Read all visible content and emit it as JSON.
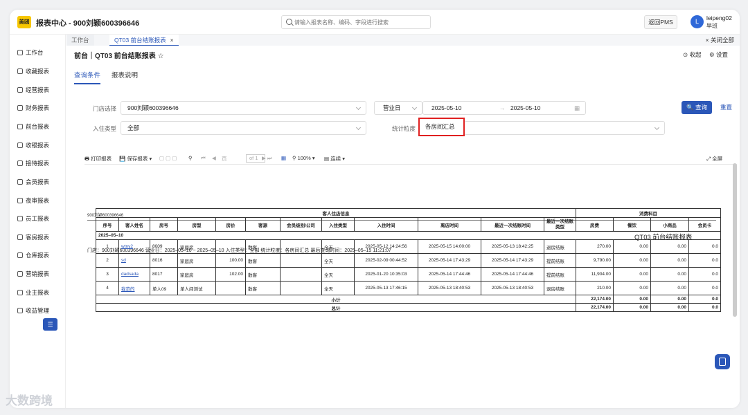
{
  "app": {
    "logo": "美团",
    "title": "报表中心 - 900刘颖600396646"
  },
  "search": {
    "placeholder": "请输入报表名称、编码、字段进行搜索"
  },
  "header": {
    "pms_button": "返回PMS",
    "avatar_letter": "L",
    "username": "leipeng02",
    "shift": "早班"
  },
  "sidebar": {
    "items": [
      {
        "label": "工作台",
        "icon": "home-icon"
      },
      {
        "label": "收藏报表",
        "icon": "star-icon"
      },
      {
        "label": "经营报表",
        "icon": "chart-icon"
      },
      {
        "label": "财务报表",
        "icon": "finance-icon"
      },
      {
        "label": "前台报表",
        "icon": "user-icon"
      },
      {
        "label": "收银报表",
        "icon": "cashier-icon"
      },
      {
        "label": "接待报表",
        "icon": "reception-icon"
      },
      {
        "label": "会员报表",
        "icon": "member-icon"
      },
      {
        "label": "夜审报表",
        "icon": "moon-icon"
      },
      {
        "label": "员工报表",
        "icon": "staff-icon"
      },
      {
        "label": "客房报表",
        "icon": "room-icon"
      },
      {
        "label": "仓库报表",
        "icon": "warehouse-icon"
      },
      {
        "label": "营销报表",
        "icon": "marketing-icon"
      },
      {
        "label": "业主报表",
        "icon": "owner-icon"
      },
      {
        "label": "收益管理",
        "icon": "revenue-icon"
      }
    ],
    "collapse_icon": "menu-icon"
  },
  "tabs": [
    {
      "label": "工作台"
    },
    {
      "label": "QT03 前台结账报表",
      "close": "×"
    }
  ],
  "close_all": "× 关闭全部",
  "page": {
    "title": "前台｜QT03 前台结账报表",
    "star": "☆",
    "collapse": "收起",
    "settings": "设置",
    "query_tabs": [
      "查询条件",
      "报表说明"
    ]
  },
  "form": {
    "store_label": "门店选择",
    "store_value": "900刘颖600396646",
    "bizdate_label": "营业日",
    "date_from": "2025-05-10",
    "date_to": "2025-05-10",
    "arrow": "→",
    "stay_label": "入住类型",
    "stay_value": "全部",
    "granularity_label": "统计粒度",
    "granularity_value": "各房间汇总",
    "query_button": "查询",
    "reset_button": "重置"
  },
  "toolbar": {
    "print": "打印报表",
    "save": "保存报表",
    "page_label": "页",
    "page_of": "of 1",
    "zoom": "100%",
    "view": "连续",
    "fullscreen": "全屏"
  },
  "report": {
    "store_line": "900刘颖600396646",
    "title": "QT03 前台结账报表",
    "info": "门店：900刘颖600396646    营业日：2025–05–10 ~ 2025–05–10    入住类型：全部    统计粒度：各房间汇总    最后查询时间：2025–05–15 11:21:07",
    "group_guest": "客人住店信息",
    "group_consume": "消费科目",
    "headers": [
      "序号",
      "客人姓名",
      "房号",
      "房型",
      "房价",
      "客源",
      "会员级别/公司",
      "入住类型",
      "入住时间",
      "离店时间",
      "最近一次结账时间",
      "最近一次结账类型",
      "房费",
      "餐饮",
      "小商品",
      "会员卡"
    ],
    "date_group": "2025–05–10",
    "rows": [
      [
        "1",
        "wtny2",
        "8009",
        "家庭房",
        "",
        "散客",
        "",
        "全天",
        "2025-05-12 14:24:56",
        "2025-05-15 14:00:00",
        "2025-05-13 18:42:25",
        "退房结账",
        "270.00",
        "0.00",
        "0.00",
        "0.0"
      ],
      [
        "2",
        "sd",
        "8016",
        "家庭房",
        "100.00",
        "散客",
        "",
        "全天",
        "2025-02-09 00:44:52",
        "2025-05-14 17:43:29",
        "2025-05-14 17:43:29",
        "提前结账",
        "9,790.00",
        "0.00",
        "0.00",
        "0.0"
      ],
      [
        "3",
        "dadsada",
        "8017",
        "家庭房",
        "102.00",
        "散客",
        "",
        "全天",
        "2025-01-20 10:35:03",
        "2025-05-14 17:44:46",
        "2025-05-14 17:44:46",
        "提前结账",
        "11,904.00",
        "0.00",
        "0.00",
        "0.0"
      ],
      [
        "4",
        "我范的",
        "单人09",
        "单人间测试",
        "",
        "散客",
        "",
        "全天",
        "2025-05-13 17:46:15",
        "2025-05-13 18:40:53",
        "2025-05-13 18:40:53",
        "退房结账",
        "210.00",
        "0.00",
        "0.00",
        "0.0"
      ]
    ],
    "subtotal_label": "小计",
    "subtotal": [
      "22,174.00",
      "0.00",
      "0.00",
      "0.0"
    ],
    "total_label": "总计",
    "total": [
      "22,174.00",
      "0.00",
      "0.00",
      "0.0"
    ]
  },
  "watermark": "大数跨境"
}
